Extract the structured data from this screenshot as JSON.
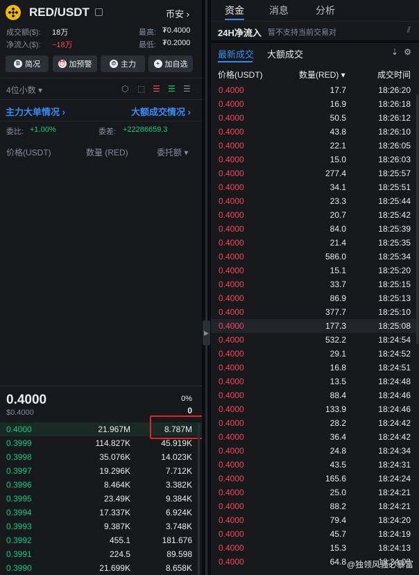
{
  "header": {
    "pair": "RED/USDT",
    "exchange": "币安",
    "turnover_label": "成交额($):",
    "turnover_value": "18万",
    "netflow_label": "净流入($):",
    "netflow_value": "−18万",
    "high_label": "最高:",
    "high_value": "₮0.4000",
    "low_label": "最低:",
    "low_value": "₮0.2000"
  },
  "buttons": [
    {
      "icon": "B",
      "label": "简况"
    },
    {
      "icon": "⏰",
      "label": "加预警"
    },
    {
      "icon": "⏱",
      "label": "主力"
    },
    {
      "icon": "+",
      "label": "加自选"
    }
  ],
  "orderbook": {
    "precision": "4位小数",
    "main_order_link": "主力大单情况",
    "large_trade_link": "大额成交情况",
    "ratio_label": "委比:",
    "ratio_value": "+1.00%",
    "diff_label": "委差:",
    "diff_value": "+22286659.3",
    "col_price": "价格(USDT)",
    "col_qty": "数量 (RED)",
    "col_amount": "委托额",
    "last_price": "0.4000",
    "last_price_usd": "$0.4000",
    "change_pct": "0%",
    "change_abs": "0",
    "bids": [
      {
        "price": "0.4000",
        "qty": "21.967M",
        "total": "8.787M"
      },
      {
        "price": "0.3999",
        "qty": "114.827K",
        "total": "45.919K"
      },
      {
        "price": "0.3998",
        "qty": "35.076K",
        "total": "14.023K"
      },
      {
        "price": "0.3997",
        "qty": "19.296K",
        "total": "7.712K"
      },
      {
        "price": "0.3996",
        "qty": "8.464K",
        "total": "3.382K"
      },
      {
        "price": "0.3995",
        "qty": "23.49K",
        "total": "9.384K"
      },
      {
        "price": "0.3994",
        "qty": "17.337K",
        "total": "6.924K"
      },
      {
        "price": "0.3993",
        "qty": "9.387K",
        "total": "3.748K"
      },
      {
        "price": "0.3992",
        "qty": "455.1",
        "total": "181.676"
      },
      {
        "price": "0.3991",
        "qty": "224.5",
        "total": "89.598"
      },
      {
        "price": "0.3990",
        "qty": "21.699K",
        "total": "8.658K"
      }
    ]
  },
  "right": {
    "tabs": [
      "资金",
      "消息",
      "分析"
    ],
    "netflow_title": "24H净流入",
    "netflow_note": "暂不支持当前交易对",
    "subtabs": [
      "最新成交",
      "大额成交"
    ],
    "col_price": "价格(USDT)",
    "col_qty": "数量(RED)",
    "col_time": "成交时间",
    "trades": [
      {
        "price": "0.4000",
        "qty": "17.7",
        "time": "18:26:20"
      },
      {
        "price": "0.4000",
        "qty": "16.9",
        "time": "18:26:18"
      },
      {
        "price": "0.4000",
        "qty": "50.5",
        "time": "18:26:12"
      },
      {
        "price": "0.4000",
        "qty": "43.8",
        "time": "18:26:10"
      },
      {
        "price": "0.4000",
        "qty": "22.1",
        "time": "18:26:05"
      },
      {
        "price": "0.4000",
        "qty": "15.0",
        "time": "18:26:03"
      },
      {
        "price": "0.4000",
        "qty": "277.4",
        "time": "18:25:57"
      },
      {
        "price": "0.4000",
        "qty": "34.1",
        "time": "18:25:51"
      },
      {
        "price": "0.4000",
        "qty": "23.3",
        "time": "18:25:44"
      },
      {
        "price": "0.4000",
        "qty": "20.7",
        "time": "18:25:42"
      },
      {
        "price": "0.4000",
        "qty": "84.0",
        "time": "18:25:39"
      },
      {
        "price": "0.4000",
        "qty": "21.4",
        "time": "18:25:35"
      },
      {
        "price": "0.4000",
        "qty": "586.0",
        "time": "18:25:34"
      },
      {
        "price": "0.4000",
        "qty": "15.1",
        "time": "18:25:20"
      },
      {
        "price": "0.4000",
        "qty": "33.7",
        "time": "18:25:15"
      },
      {
        "price": "0.4000",
        "qty": "86.9",
        "time": "18:25:13"
      },
      {
        "price": "0.4000",
        "qty": "377.7",
        "time": "18:25:10"
      },
      {
        "price": "0.4000",
        "qty": "177.3",
        "time": "18:25:08"
      },
      {
        "price": "0.4000",
        "qty": "532.2",
        "time": "18:24:54"
      },
      {
        "price": "0.4000",
        "qty": "29.1",
        "time": "18:24:52"
      },
      {
        "price": "0.4000",
        "qty": "16.8",
        "time": "18:24:51"
      },
      {
        "price": "0.4000",
        "qty": "13.5",
        "time": "18:24:48"
      },
      {
        "price": "0.4000",
        "qty": "88.4",
        "time": "18:24:46"
      },
      {
        "price": "0.4000",
        "qty": "133.9",
        "time": "18:24:46"
      },
      {
        "price": "0.4000",
        "qty": "28.2",
        "time": "18:24:42"
      },
      {
        "price": "0.4000",
        "qty": "36.4",
        "time": "18:24:42"
      },
      {
        "price": "0.4000",
        "qty": "24.8",
        "time": "18:24:34"
      },
      {
        "price": "0.4000",
        "qty": "43.5",
        "time": "18:24:31"
      },
      {
        "price": "0.4000",
        "qty": "165.6",
        "time": "18:24:24"
      },
      {
        "price": "0.4000",
        "qty": "25.0",
        "time": "18:24:21"
      },
      {
        "price": "0.4000",
        "qty": "88.2",
        "time": "18:24:21"
      },
      {
        "price": "0.4000",
        "qty": "79.4",
        "time": "18:24:20"
      },
      {
        "price": "0.4000",
        "qty": "45.7",
        "time": "18:24:19"
      },
      {
        "price": "0.4000",
        "qty": "15.3",
        "time": "18:24:13"
      },
      {
        "price": "0.4000",
        "qty": "64.8",
        "time": "18:24:08"
      }
    ],
    "watermark": "@独领风骚必暴富"
  },
  "colors": {
    "up": "#0ecb81",
    "down": "#f6465d",
    "accent": "#3b8bf5",
    "coin": "#f0b90b",
    "highlight_box": "#e0262a"
  }
}
